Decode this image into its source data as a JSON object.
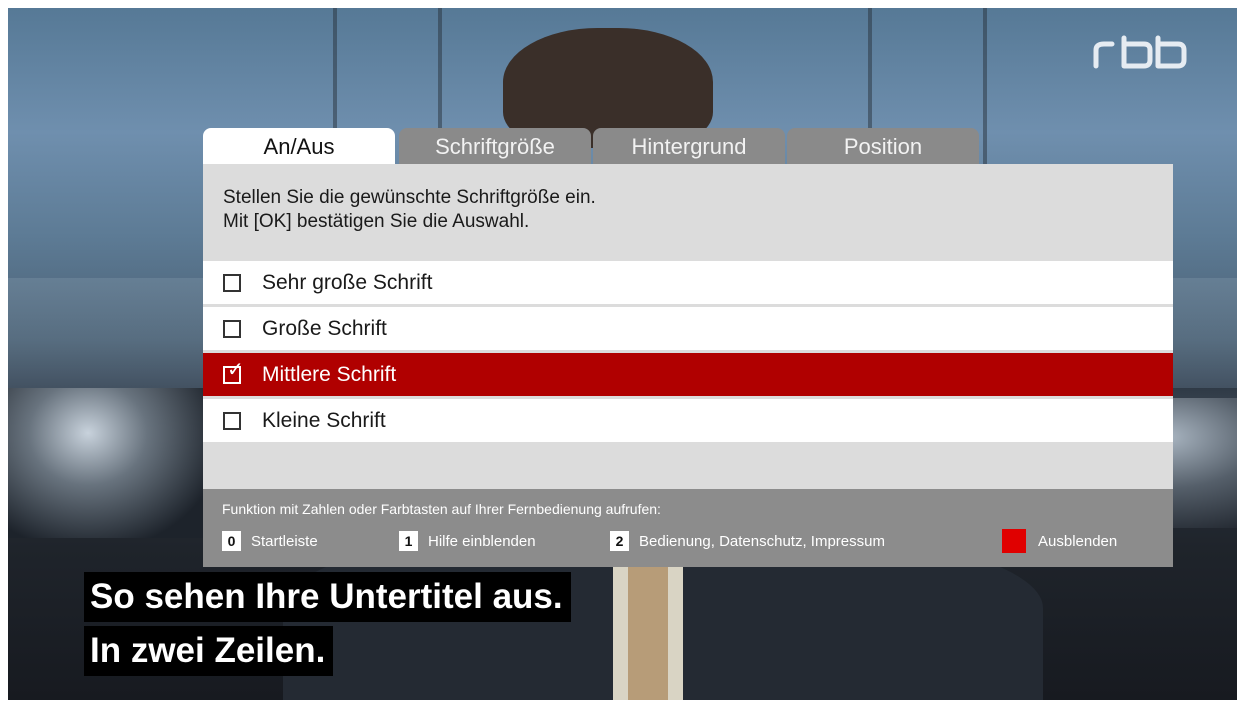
{
  "broadcaster_logo": "rbb",
  "colors": {
    "selected": "#b00000",
    "tab_inactive": "#8a8a8a",
    "footer": "#8c8c8c",
    "red_key": "#e00000"
  },
  "tabs": [
    {
      "label": "An/Aus",
      "active": true
    },
    {
      "label": "Schriftgröße",
      "active": false
    },
    {
      "label": "Hintergrund",
      "active": false
    },
    {
      "label": "Position",
      "active": false
    }
  ],
  "instructions": {
    "line1": "Stellen Sie die gewünschte Schriftgröße ein.",
    "line2": "Mit [OK] bestätigen Sie die Auswahl."
  },
  "options": [
    {
      "label": "Sehr große Schrift",
      "checked": false
    },
    {
      "label": "Große Schrift",
      "checked": false
    },
    {
      "label": "Mittlere Schrift",
      "checked": true
    },
    {
      "label": "Kleine Schrift",
      "checked": false
    }
  ],
  "footer": {
    "title": "Funktion mit Zahlen oder Farbtasten auf Ihrer Fernbedienung aufrufen:",
    "keys": [
      {
        "key": "0",
        "label": "Startleiste"
      },
      {
        "key": "1",
        "label": "Hilfe einblenden"
      },
      {
        "key": "2",
        "label": "Bedienung, Datenschutz, Impressum"
      }
    ],
    "red_key_label": "Ausblenden"
  },
  "subtitles": {
    "line1": "So sehen Ihre Untertitel aus.",
    "line2": "In zwei Zeilen."
  }
}
